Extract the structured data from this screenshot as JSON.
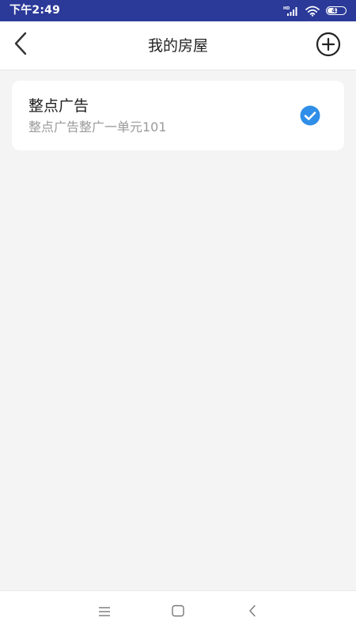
{
  "status_bar": {
    "time": "下午2:49",
    "battery_level": "48",
    "network_badge": "HD",
    "icons": [
      "signal-icon",
      "wifi-icon",
      "battery-icon"
    ],
    "background_color": "#2b3a99"
  },
  "header": {
    "title": "我的房屋",
    "back_icon": "chevron-left-icon",
    "add_icon": "plus-circle-icon"
  },
  "houses": [
    {
      "name": "整点广告",
      "address": "整点广告整广一单元101",
      "selected": true,
      "check_icon": "check-circle-icon",
      "check_color": "#2f8ee8"
    }
  ],
  "nav_bar": {
    "icons": [
      "menu-icon",
      "home-icon",
      "back-icon"
    ]
  }
}
